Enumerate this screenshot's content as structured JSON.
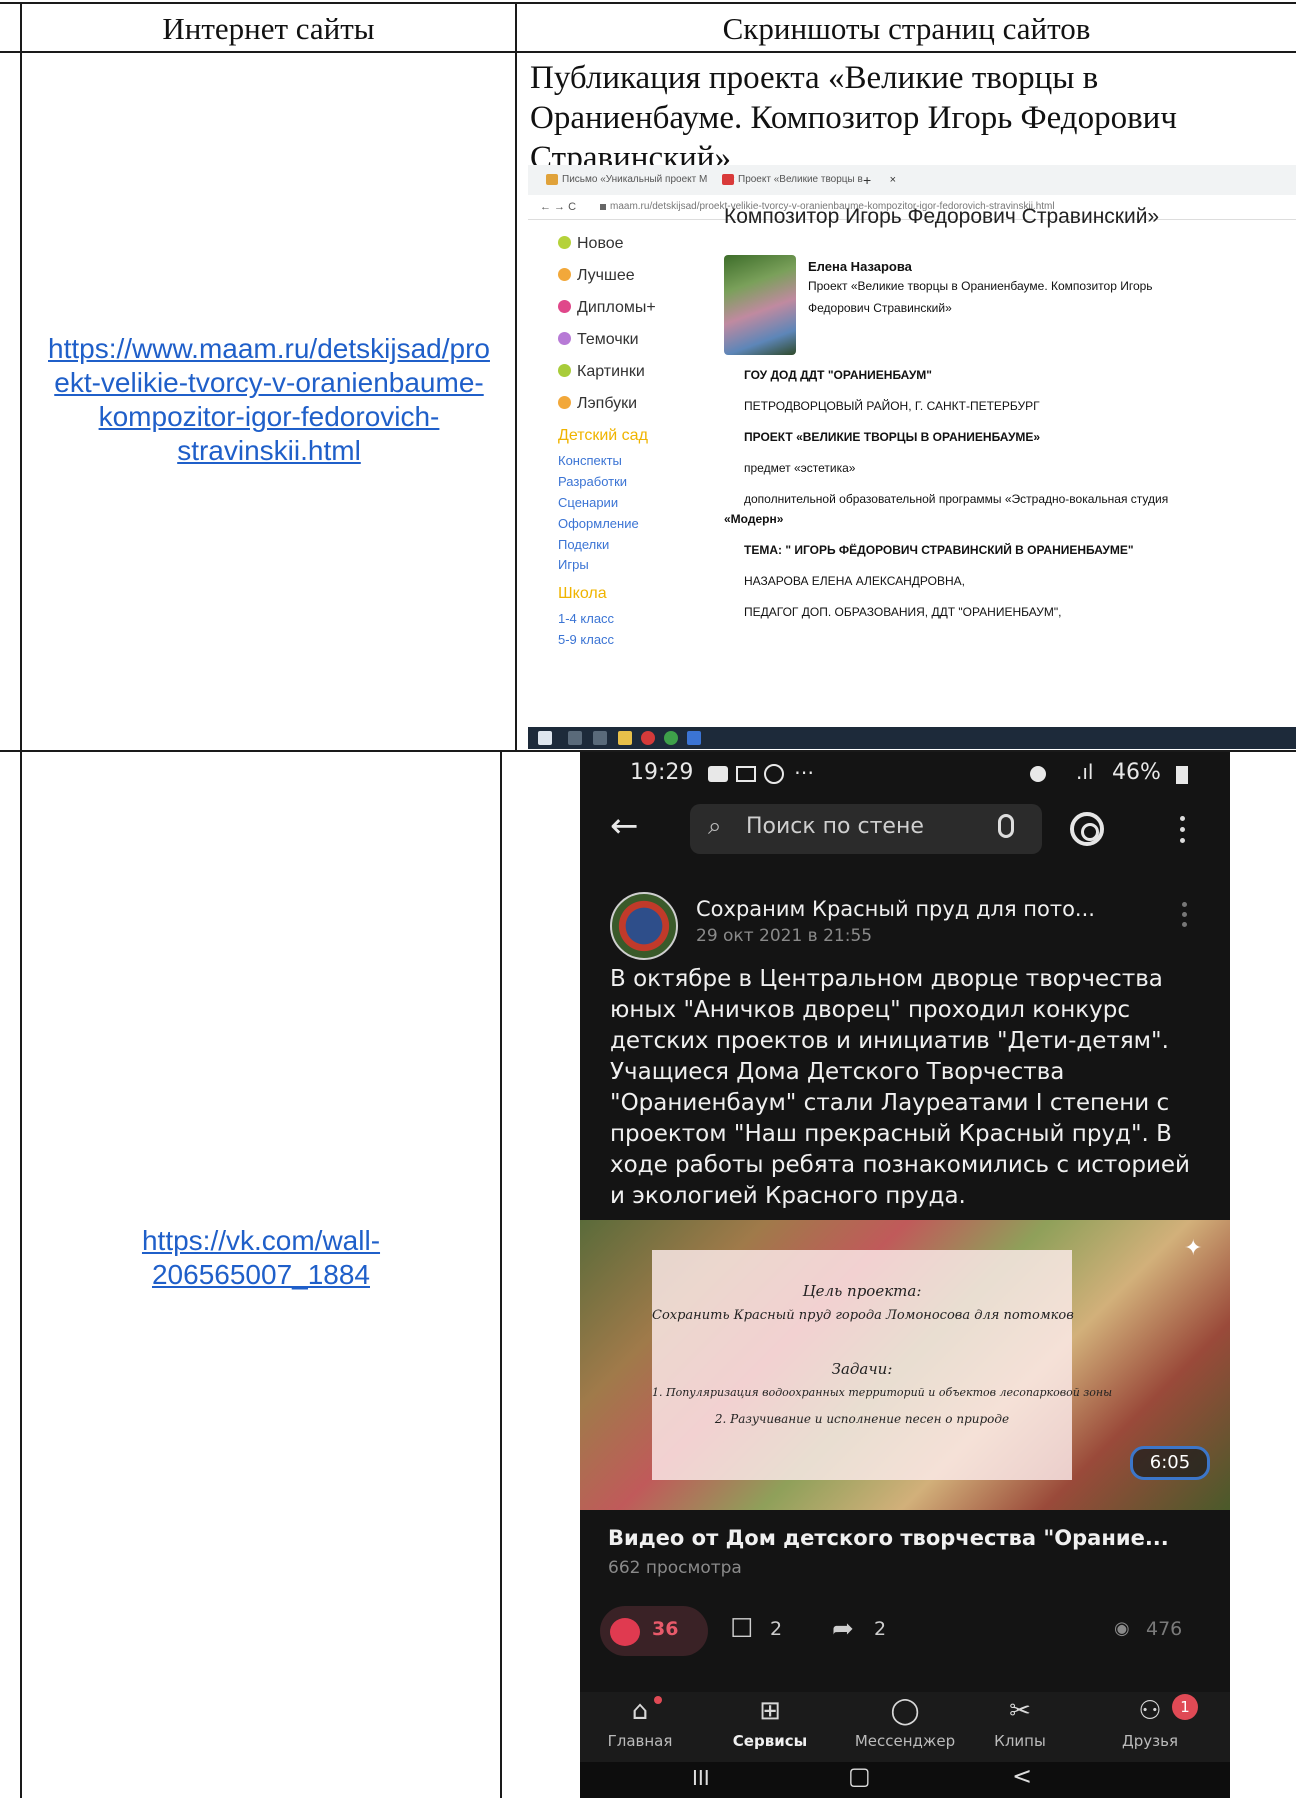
{
  "table": {
    "headers": [
      "Интернет сайты",
      "Скриншоты страниц сайтов"
    ],
    "rows": [
      {
        "url_lines": [
          "https://www.maam.ru/detskijsad/pro",
          "ekt-velikie-tvorcy-v-oranienbaume-",
          "kompozitor-igor-fedorovich-",
          "stravinskii.html"
        ],
        "pub_title_lines": [
          "Публикация проекта «Великие творцы в",
          "Ораниенбауме. Композитор Игорь Федорович",
          "Стравинский»"
        ]
      },
      {
        "url_lines": [
          "https://vk.com/wall-",
          "206565007_1884"
        ]
      }
    ]
  },
  "browser": {
    "tabs": [
      "Письмо «Уникальный проект М",
      "Проект «Великие творцы в Ора"
    ],
    "tab_close": "×",
    "new_tab": "+",
    "nav": "←  →  C",
    "address": "maam.ru/detskijsad/proekt-velikie-tvorcy-v-oranienbaume-kompozitor-igor-fedorovich-stravinskii.html",
    "sidebar": {
      "items": [
        {
          "label": "Новое",
          "color": "#b5d23a"
        },
        {
          "label": "Лучшее",
          "color": "#f2a83a"
        },
        {
          "label": "Дипломы+",
          "color": "#e0478a"
        },
        {
          "label": "Темочки",
          "color": "#b77ad6"
        },
        {
          "label": "Картинки",
          "color": "#a8cc3a"
        },
        {
          "label": "Лэпбуки",
          "color": "#f2a83a"
        }
      ],
      "section1": "Детский сад",
      "links1": [
        "Конспекты",
        "Разработки",
        "Сценарии",
        "Оформление",
        "Поделки",
        "Игры"
      ],
      "section2": "Школа",
      "links2": [
        "1-4 класс",
        "5-9 класс"
      ]
    },
    "article": {
      "heading": "Композитор Игорь Федорович Стравинский»",
      "author": "Елена Назарова",
      "desc_lines": [
        "Проект «Великие творцы в Ораниенбауме. Композитор Игорь",
        "Федорович Стравинский»"
      ],
      "lines": [
        "ГОУ ДОД ДДТ \"ОРАНИЕНБАУМ\"",
        "ПЕТРОДВОРЦОВЫЙ РАЙОН, Г. САНКТ-ПЕТЕРБУРГ",
        "ПРОЕКТ «ВЕЛИКИЕ ТВОРЦЫ В ОРАНИЕНБАУМЕ»",
        "предмет «эстетика»",
        "дополнительной образовательной программы «Эстрадно-вокальная студия",
        "«Модерн»",
        "ТЕМА: \" ИГОРЬ ФЁДОРОВИЧ СТРАВИНСКИЙ В ОРАНИЕНБАУМЕ\"",
        "НАЗАРОВА ЕЛЕНА АЛЕКСАНДРОВНА,",
        "ПЕДАГОГ ДОП. ОБРАЗОВАНИЯ, ДДТ \"ОРАНИЕНБАУМ\","
      ]
    }
  },
  "phone": {
    "time": "19:29",
    "status_icons": "⋯",
    "battery": "46%",
    "signal": ".ıl",
    "search_placeholder": "Поиск по стене",
    "community": "Сохраним Красный пруд для пото...",
    "date": "29 окт 2021 в 21:55",
    "post_text": "В октябре в Центральном дворце творчества юных \"Аничков дворец\" проходил конкурс детских проектов и инициатив \"Дети-детям\". Учащиеся Дома Детского Творчества \"Ораниенбаум\" стали Лауреатами I степени с проектом \"Наш прекрасный Красный пруд\". В ходе работы ребята познакомились с историей и экологией Красного пруда.",
    "video_card": {
      "goal_title": "Цель проекта:",
      "goal": "Сохранить Красный пруд города Ломоносова для потомков",
      "tasks_title": "Задачи:",
      "task1": "1. Популяризация водоохранных территорий и объектов лесопарковой зоны",
      "task2": "2. Разучивание и исполнение песен о природе"
    },
    "duration": "6:05",
    "video_title": "Видео от Дом детского творчества \"Орание...",
    "views": "662 просмотра",
    "likes": "36",
    "comments": "2",
    "shares": "2",
    "post_views": "476",
    "nav": [
      {
        "label": "Главная",
        "icon": "home-icon",
        "glyph": "⌂"
      },
      {
        "label": "Сервисы",
        "icon": "services-icon",
        "glyph": "⊞"
      },
      {
        "label": "Мессенджер",
        "icon": "messenger-icon",
        "glyph": "◯"
      },
      {
        "label": "Клипы",
        "icon": "clips-icon",
        "glyph": "✂"
      },
      {
        "label": "Друзья",
        "icon": "friends-icon",
        "glyph": "⚇"
      }
    ],
    "friends_badge": "1",
    "sys_nav": [
      "III",
      "▢",
      "<"
    ]
  }
}
